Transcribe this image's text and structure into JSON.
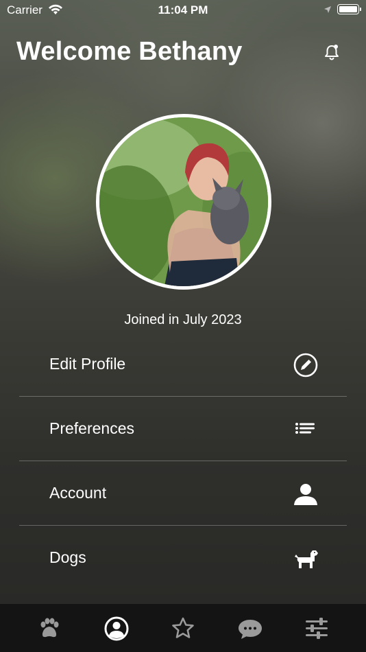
{
  "status_bar": {
    "carrier": "Carrier",
    "time": "11:04 PM"
  },
  "header": {
    "title": "Welcome Bethany"
  },
  "profile": {
    "joined_text": "Joined in July 2023"
  },
  "menu": {
    "items": [
      {
        "label": "Edit Profile",
        "icon": "edit-pencil-icon"
      },
      {
        "label": "Preferences",
        "icon": "list-icon"
      },
      {
        "label": "Account",
        "icon": "person-icon"
      },
      {
        "label": "Dogs",
        "icon": "dog-icon"
      }
    ]
  },
  "tab_bar": {
    "tabs": [
      {
        "icon": "paw-icon",
        "active": false
      },
      {
        "icon": "profile-icon",
        "active": true
      },
      {
        "icon": "star-icon",
        "active": false
      },
      {
        "icon": "chat-icon",
        "active": false
      },
      {
        "icon": "sliders-icon",
        "active": false
      }
    ]
  },
  "colors": {
    "text": "#ffffff",
    "tab_bar_bg": "#141414",
    "tab_inactive": "#9a9a9a"
  }
}
